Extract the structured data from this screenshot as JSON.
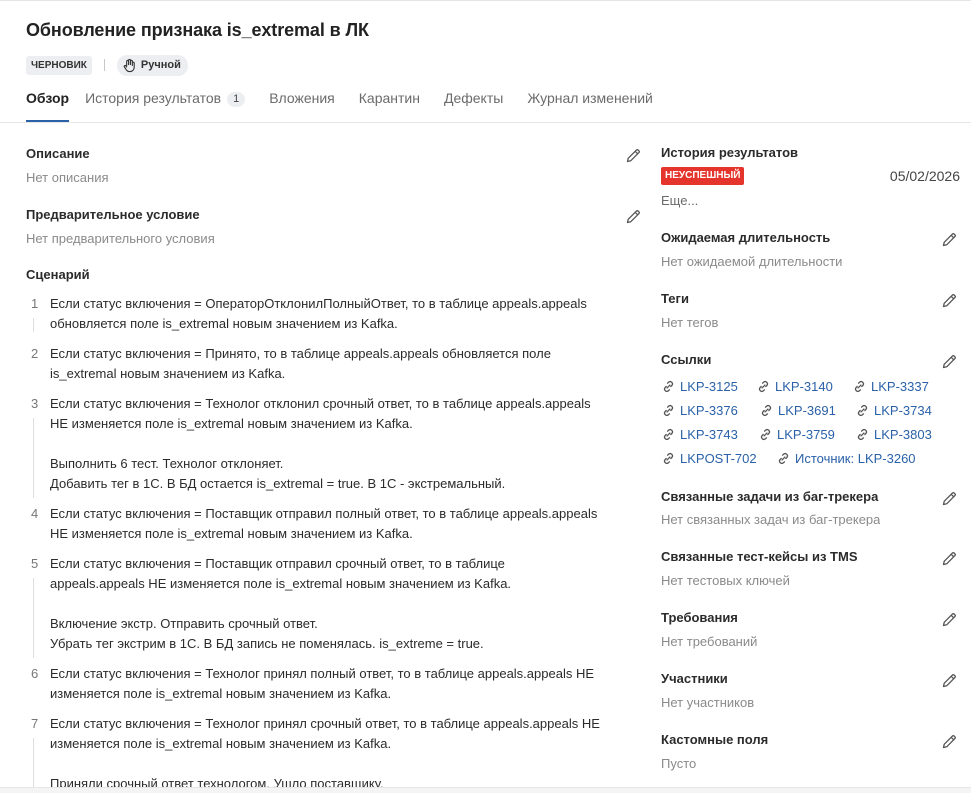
{
  "title": "Обновление признака is_extremal в ЛК",
  "badges": {
    "status": "ЧЕРНОВИК",
    "type": "Ручной"
  },
  "tabs": [
    {
      "label": "Обзор"
    },
    {
      "label": "История результатов",
      "count": "1"
    },
    {
      "label": "Вложения"
    },
    {
      "label": "Карантин"
    },
    {
      "label": "Дефекты"
    },
    {
      "label": "Журнал изменений"
    }
  ],
  "left": {
    "description": {
      "label": "Описание",
      "value": "Нет описания"
    },
    "precondition": {
      "label": "Предварительное условие",
      "value": "Нет предварительного условия"
    },
    "scenario_label": "Сценарий",
    "steps": [
      {
        "num": "1",
        "lines": [
          "Если статус включения = ОператорОтклонилПолныйОтвет, то в таблице appeals.appeals",
          "обновляется поле is_extremal новым значением из Kafka."
        ]
      },
      {
        "num": "2",
        "lines": [
          "Если статус включения = Принято, то в таблице appeals.appeals обновляется поле",
          "is_extremal новым значением из Kafka."
        ]
      },
      {
        "num": "3",
        "lines": [
          "Если статус включения = Технолог отклонил срочный ответ, то в таблице appeals.appeals",
          "НЕ изменяется поле is_extremal новым значением из Kafka.",
          "",
          "Выполнить 6 тест. Технолог отклоняет.",
          "Добавить тег в 1С. В БД остается is_extremal = true. В 1С - экстремальный."
        ]
      },
      {
        "num": "4",
        "lines": [
          "Если статус включения = Поставщик отправил полный ответ, то в таблице appeals.appeals",
          "НЕ изменяется поле is_extremal новым значением из Kafka."
        ]
      },
      {
        "num": "5",
        "lines": [
          "Если статус включения = Поставщик отправил срочный ответ, то в таблице",
          "appeals.appeals НЕ изменяется поле is_extremal новым значением из Kafka.",
          "",
          "Включение экстр. Отправить срочный ответ.",
          "Убрать тег экстрим в 1С. В БД запись не поменялась. is_extreme = true."
        ]
      },
      {
        "num": "6",
        "lines": [
          "Если статус включения = Технолог принял полный ответ, то в таблице appeals.appeals НЕ",
          "изменяется поле is_extremal новым значением из Kafka."
        ]
      },
      {
        "num": "7",
        "lines": [
          "Если статус включения = Технолог принял срочный ответ, то в таблице appeals.appeals НЕ",
          "изменяется поле is_extremal новым значением из Kafka.",
          "",
          "Приняли срочный ответ технологом. Ушло поставщику."
        ]
      }
    ]
  },
  "right": {
    "history": {
      "label": "История результатов",
      "status": "НЕУСПЕШНЫЙ",
      "date": "05/02/2026",
      "more": "Еще..."
    },
    "duration": {
      "label": "Ожидаемая длительность",
      "value": "Нет ожидаемой длительности"
    },
    "tags": {
      "label": "Теги",
      "value": "Нет тегов"
    },
    "links_label": "Ссылки",
    "links": [
      [
        "LKP-3125",
        "LKP-3140",
        "LKP-3337"
      ],
      [
        "LKP-3376",
        "LKP-3691",
        "LKP-3734"
      ],
      [
        "LKP-3743",
        "LKP-3759",
        "LKP-3803"
      ],
      [
        "LKPOST-702",
        "Источник: LKP-3260"
      ]
    ],
    "bug_tasks": {
      "label": "Связанные задачи из баг-трекера",
      "value": "Нет связанных задач из баг-трекера"
    },
    "tms": {
      "label": "Связанные тест-кейсы из TMS",
      "value": "Нет тестовых ключей"
    },
    "requirements": {
      "label": "Требования",
      "value": "Нет требований"
    },
    "members": {
      "label": "Участники",
      "value": "Нет участников"
    },
    "custom": {
      "label": "Кастомные поля",
      "value": "Пусто"
    }
  },
  "colors": {
    "accent": "#2a61a8",
    "fail": "#e5342b",
    "badge_bg": "#eceef1"
  },
  "icons": {
    "edit": "pencil-icon",
    "link": "link-icon",
    "manual": "hand-icon"
  }
}
